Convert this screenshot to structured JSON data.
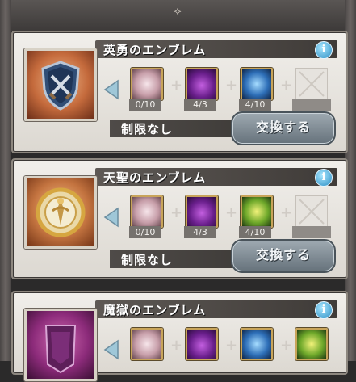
{
  "cards": [
    {
      "title": "英勇のエンブレム",
      "info_label": "i",
      "materials": [
        {
          "count": "0/10",
          "icon": "pale-pink-orb-icon"
        },
        {
          "count": "4/3",
          "icon": "purple-flame-icon"
        },
        {
          "count": "4/10",
          "icon": "blue-sphere-icon"
        }
      ],
      "limit": "制限なし",
      "exchange_label": "交換する"
    },
    {
      "title": "天聖のエンブレム",
      "info_label": "i",
      "materials": [
        {
          "count": "0/10",
          "icon": "pale-pink-orb-icon"
        },
        {
          "count": "4/3",
          "icon": "purple-flame-icon"
        },
        {
          "count": "4/10",
          "icon": "green-yellow-sphere-icon"
        }
      ],
      "limit": "制限なし",
      "exchange_label": "交換する"
    },
    {
      "title": "魔獄のエンブレム",
      "info_label": "i",
      "materials": [
        {
          "icon": "pale-pink-orb-icon"
        },
        {
          "icon": "purple-flame-icon"
        },
        {
          "icon": "blue-sphere-icon"
        },
        {
          "icon": "green-yellow-sphere-icon"
        }
      ]
    }
  ],
  "colors": {
    "card_bg": "#ece9e4",
    "title_bar": "#4f4b48",
    "info": "#2d8fc4",
    "exchange_button": "#7b8790",
    "slot_border": "#c8a45a"
  }
}
